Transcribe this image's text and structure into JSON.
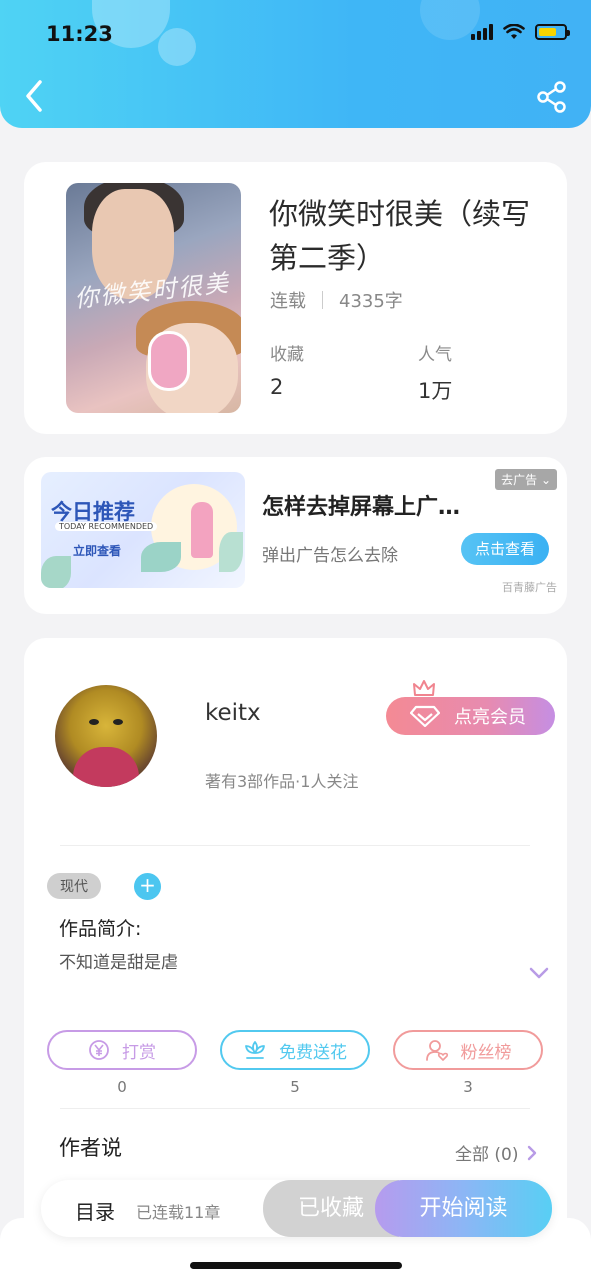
{
  "status_bar": {
    "time": "11:23"
  },
  "book": {
    "title": "你微笑时很美（续写第二季）",
    "status": "连载",
    "word_count": "4335字",
    "favorites_label": "收藏",
    "favorites_value": "2",
    "popularity_label": "人气",
    "popularity_value": "1万",
    "cover_art_text": "你微笑时很美"
  },
  "ad": {
    "image_title": "今日推荐",
    "image_subtitle": "TODAY RECOMMENDED",
    "image_cta": "立即查看",
    "title": "怎样去掉屏幕上广…",
    "subtitle": "弹出广告怎么去除",
    "close_label": "去广告",
    "button": "点击查看",
    "source": "百青藤广告"
  },
  "author": {
    "name": "keitx",
    "stats": "著有3部作品·1人关注",
    "vip_button": "点亮会员",
    "tag": "现代",
    "intro_label": "作品简介:",
    "intro_text": "不知道是甜是虐"
  },
  "actions": [
    {
      "label": "打赏",
      "count": "0",
      "color": "#c79be6",
      "icon": "yen-icon"
    },
    {
      "label": "免费送花",
      "count": "5",
      "color": "#52c9ef",
      "icon": "flower-icon"
    },
    {
      "label": "粉丝榜",
      "count": "3",
      "color": "#f19b9b",
      "icon": "fan-icon"
    }
  ],
  "author_say": {
    "label": "作者说",
    "all": "全部 (0)"
  },
  "bottom": {
    "toc": "目录",
    "chapters": "已连载11章",
    "favorited": "已收藏",
    "start_reading": "开始阅读"
  },
  "colors": {
    "header": "#41b8f6",
    "accent": "#4cc6f0"
  }
}
